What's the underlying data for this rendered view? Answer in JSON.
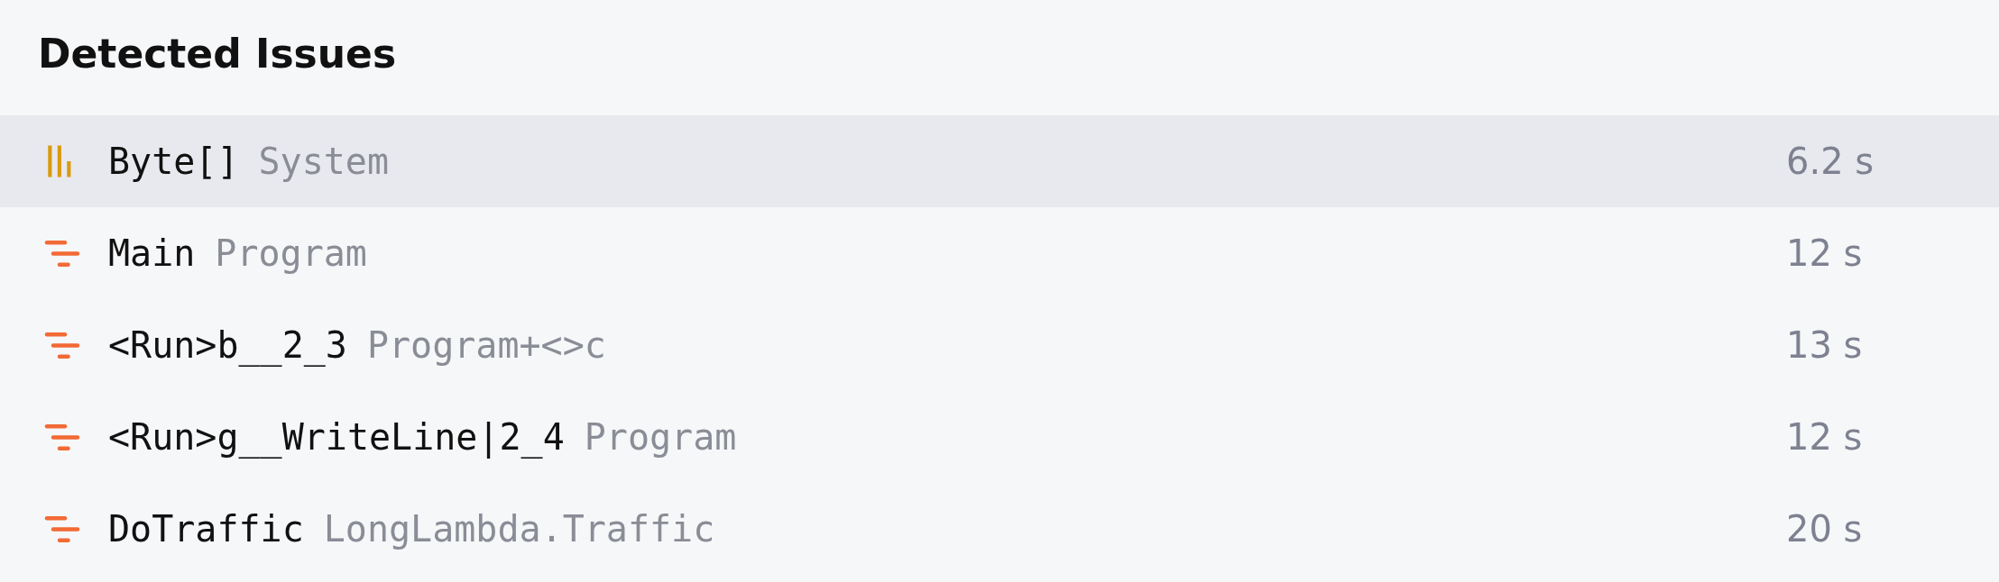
{
  "panel": {
    "title": "Detected Issues"
  },
  "issues": [
    {
      "kind": "allocation",
      "selected": true,
      "name": "Byte[]",
      "owner": "System",
      "time": "6.2 s"
    },
    {
      "kind": "slow-call",
      "selected": false,
      "name": "Main",
      "owner": "Program",
      "time": "12 s"
    },
    {
      "kind": "slow-call",
      "selected": false,
      "name": "<Run>b__2_3",
      "owner": "Program+<>c",
      "time": "13 s"
    },
    {
      "kind": "slow-call",
      "selected": false,
      "name": "<Run>g__WriteLine|2_4",
      "owner": "Program",
      "time": "12 s"
    },
    {
      "kind": "slow-call",
      "selected": false,
      "name": "DoTraffic",
      "owner": "LongLambda.Traffic",
      "time": "20 s"
    }
  ]
}
